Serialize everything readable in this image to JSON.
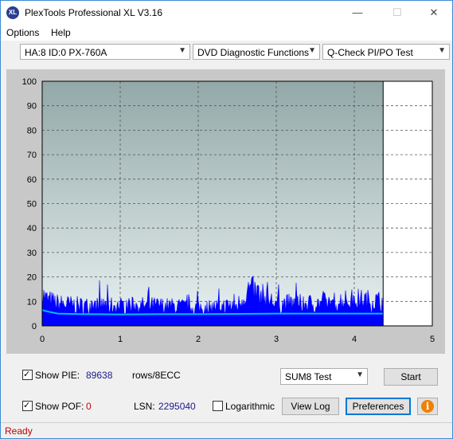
{
  "window": {
    "title": "PlexTools Professional XL V3.16",
    "icon": "XL"
  },
  "window_controls": {
    "minimize": "—",
    "maximize": "☐",
    "close": "✕"
  },
  "menu": [
    {
      "label": "Options"
    },
    {
      "label": "Help"
    }
  ],
  "toolbar": {
    "drive": "HA:8 ID:0  PX-760A",
    "function": "DVD Diagnostic Functions",
    "test": "Q-Check PI/PO Test"
  },
  "chart_data": {
    "type": "area",
    "xlim": [
      0,
      5
    ],
    "ylim": [
      0,
      100
    ],
    "x_ticks": [
      "0",
      "1",
      "2",
      "3",
      "4",
      "5"
    ],
    "y_ticks": [
      "0",
      "10",
      "20",
      "30",
      "40",
      "50",
      "60",
      "70",
      "80",
      "90",
      "100"
    ],
    "data_end_x": 4.37,
    "grid": true,
    "series": [
      {
        "color": "#0000ff",
        "x": [
          0,
          0.05,
          0.2,
          0.5,
          1.0,
          1.5,
          2.0,
          2.5,
          2.65,
          3.0,
          3.5,
          4.0,
          4.37
        ],
        "values": [
          16,
          13,
          11,
          10,
          10,
          10,
          9,
          10,
          18,
          11,
          11,
          13,
          12
        ]
      },
      {
        "color": "#00c0ff",
        "x": [
          0,
          0.05,
          0.2,
          0.5,
          1.0,
          1.5,
          2.0,
          2.5,
          3.0,
          3.5,
          4.0,
          4.37
        ],
        "values": [
          6.5,
          6,
          5,
          4.8,
          4.7,
          4.8,
          4.8,
          4.9,
          5,
          5,
          5,
          5
        ]
      }
    ],
    "end_line_color": "#000000"
  },
  "stats": {
    "show_pie_label": "Show PIE:",
    "pie_value": "89638",
    "rows_label": "rows/8ECC",
    "show_pof_label": "Show POF:",
    "pof_value": "0",
    "lsn_label": "LSN:",
    "lsn_value": "2295040",
    "log_label": "Logarithmic"
  },
  "controls": {
    "sum8": "SUM8 Test",
    "start": "Start",
    "view_log": "View Log",
    "preferences": "Preferences",
    "info": "i"
  },
  "status": {
    "text": "Ready"
  },
  "colors": {
    "accent": "#0078d7",
    "status": "#c00000"
  }
}
